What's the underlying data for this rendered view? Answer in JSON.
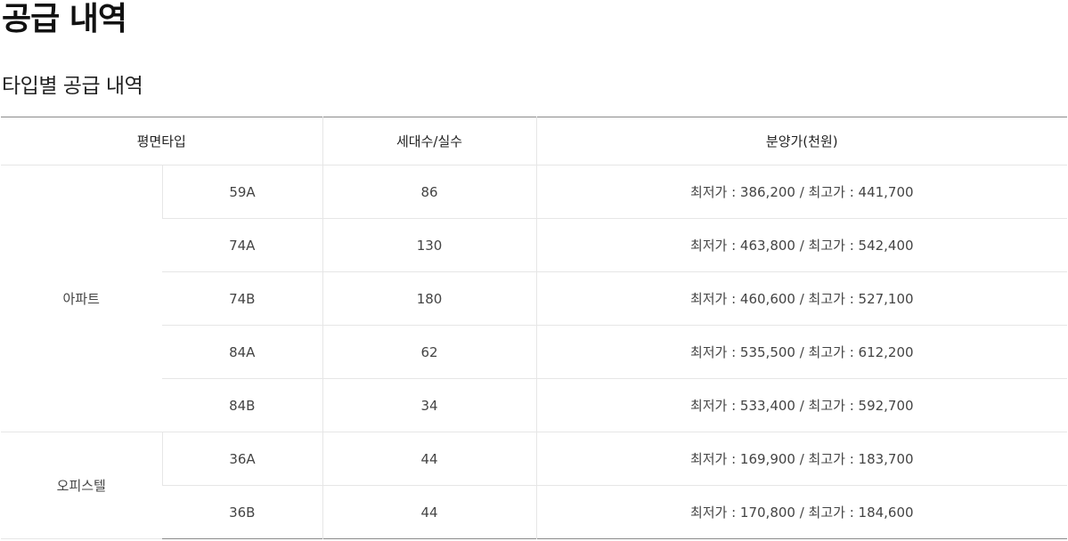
{
  "page": {
    "title": "공급 내역",
    "section_title": "타입별 공급 내역"
  },
  "table": {
    "headers": {
      "type": "평면타입",
      "units": "세대수/실수",
      "price": "분양가(천원)"
    },
    "groups": [
      {
        "name": "아파트",
        "rows": [
          {
            "type": "59A",
            "units": "86",
            "price": "최저가 : 386,200 / 최고가 : 441,700"
          },
          {
            "type": "74A",
            "units": "130",
            "price": "최저가 : 463,800 / 최고가 : 542,400"
          },
          {
            "type": "74B",
            "units": "180",
            "price": "최저가 : 460,600 / 최고가 : 527,100"
          },
          {
            "type": "84A",
            "units": "62",
            "price": "최저가 : 535,500 / 최고가 : 612,200"
          },
          {
            "type": "84B",
            "units": "34",
            "price": "최저가 : 533,400 / 최고가 : 592,700"
          }
        ]
      },
      {
        "name": "오피스텔",
        "rows": [
          {
            "type": "36A",
            "units": "44",
            "price": "최저가 : 169,900 / 최고가 : 183,700"
          },
          {
            "type": "36B",
            "units": "44",
            "price": "최저가 : 170,800 / 최고가 : 184,600"
          }
        ]
      }
    ]
  }
}
